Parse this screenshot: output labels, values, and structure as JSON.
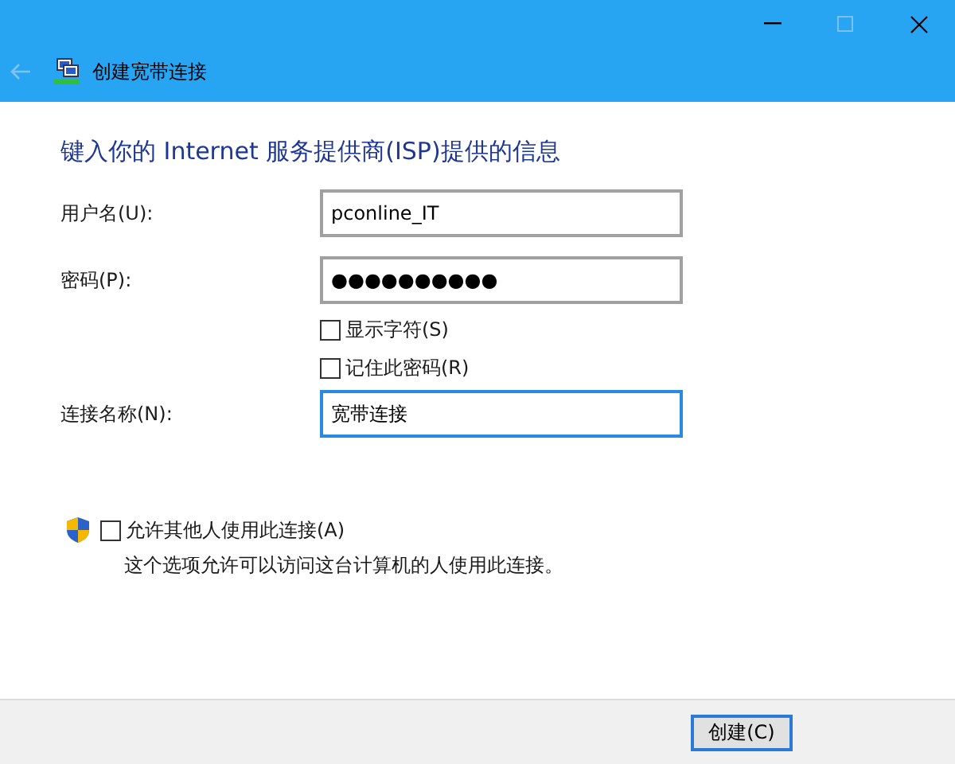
{
  "title_bar": {
    "back_disabled": true,
    "title": "创建宽带连接"
  },
  "heading": "键入你的 Internet 服务提供商(ISP)提供的信息",
  "fields": [
    {
      "label": "用户名(U):",
      "value": "pconline_IT",
      "focused": false
    },
    {
      "label": "密码(P):",
      "value": "●●●●●●●●●●",
      "focused": false
    },
    {
      "label": "连接名称(N):",
      "value": "宽带连接",
      "focused": true
    }
  ],
  "password_options": [
    {
      "label": "显示字符(S)",
      "checked": false
    },
    {
      "label": "记住此密码(R)",
      "checked": false
    }
  ],
  "allow_others": {
    "label": "允许其他人使用此连接(A)",
    "checked": false,
    "description": "这个选项允许可以访问这台计算机的人使用此连接。"
  },
  "buttons": [
    {
      "label": "创建(C)",
      "default": true
    }
  ]
}
